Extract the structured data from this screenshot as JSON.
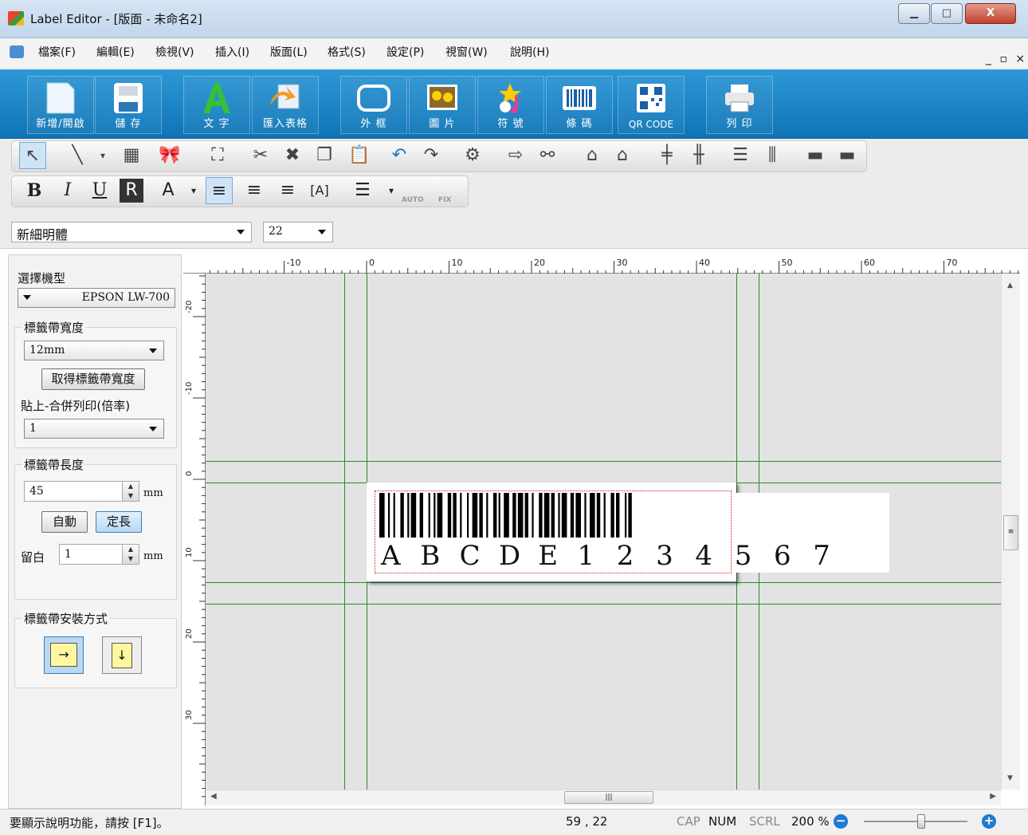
{
  "title": "Label Editor - [版面 - 未命名2]",
  "window_controls": {
    "minimize": "▁",
    "maximize": "□",
    "close": "X"
  },
  "menu": [
    "檔案(F)",
    "編輯(E)",
    "檢視(V)",
    "插入(I)",
    "版面(L)",
    "格式(S)",
    "設定(P)",
    "視窗(W)",
    "說明(H)"
  ],
  "mdi_controls": "_ ▫ ×",
  "ribbon": [
    {
      "label": "新增/開啟",
      "icon": "new-document-icon"
    },
    {
      "label": "儲 存",
      "icon": "save-icon"
    },
    {
      "label": "文 字",
      "icon": "text-icon"
    },
    {
      "label": "匯入表格",
      "icon": "import-table-icon"
    },
    {
      "label": "外 框",
      "icon": "frame-icon"
    },
    {
      "label": "圖 片",
      "icon": "picture-icon"
    },
    {
      "label": "符 號",
      "icon": "symbol-icon"
    },
    {
      "label": "條 碼",
      "icon": "barcode-icon"
    },
    {
      "label": "QR CODE",
      "icon": "qrcode-icon"
    },
    {
      "label": "列 印",
      "icon": "print-icon"
    }
  ],
  "format_bar": {
    "bold": "B",
    "italic": "I",
    "underline": "U",
    "font_color": "A",
    "auto": "AUTO",
    "fix": "FIX"
  },
  "font": {
    "name": "新細明體",
    "size": "22"
  },
  "left_panel": {
    "model_label": "選擇機型",
    "model_value": "EPSON LW-700",
    "tape_width_label": "標籤帶寬度",
    "tape_width_value": "12mm",
    "get_width_button": "取得標籤帶寬度",
    "paste_merge_label": "貼上-合併列印(倍率)",
    "paste_merge_value": "1",
    "tape_length_label": "標籤帶長度",
    "tape_length_value": "45",
    "unit": "mm",
    "auto_button": "自動",
    "fixed_button": "定長",
    "margin_label": "留白",
    "margin_value": "1",
    "install_label": "標籤帶安裝方式"
  },
  "ruler": {
    "top": [
      "-10",
      "0",
      "10",
      "20",
      "30",
      "40",
      "50",
      "60",
      "70"
    ],
    "left": [
      "-20",
      "-10",
      "0",
      "10",
      "20",
      "30"
    ]
  },
  "barcode_text": [
    "A",
    "B",
    "C",
    "D",
    "E",
    "1",
    "2",
    "3",
    "4",
    "5",
    "6",
    "7"
  ],
  "status": {
    "help": "要顯示說明功能，請按 [F1]。",
    "coords": "59 , 22",
    "cap": "CAP",
    "num": "NUM",
    "scrl": "SCRL",
    "zoom": "200 %"
  },
  "zoom_level": 0.55
}
